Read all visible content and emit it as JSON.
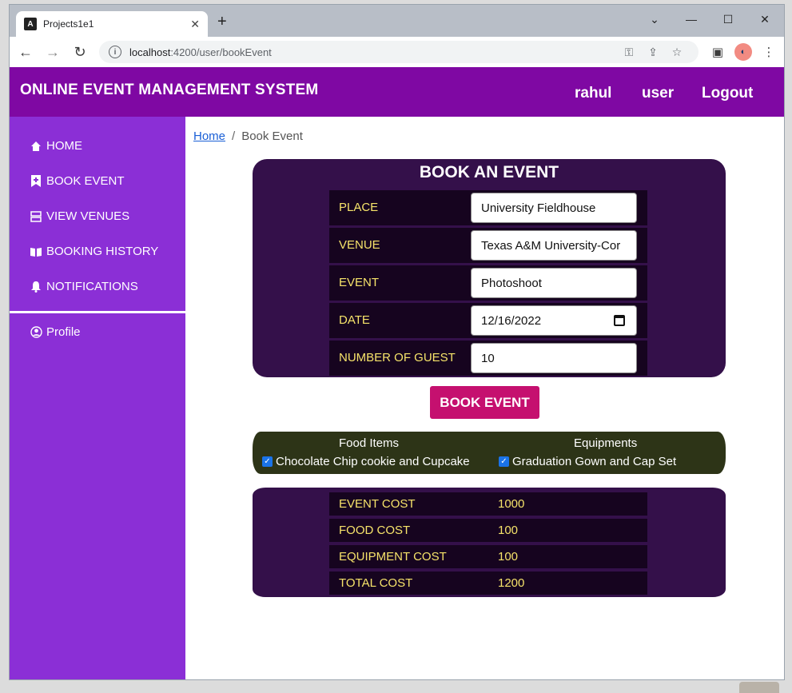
{
  "browser": {
    "tab_title": "Projects1e1",
    "new_tab": "+",
    "url_host": "localhost",
    "url_path": ":4200/user/bookEvent"
  },
  "header": {
    "app_title": "ONLINE EVENT MANAGEMENT SYSTEM",
    "user_name": "rahul",
    "role": "user",
    "logout": "Logout"
  },
  "sidebar": {
    "items": [
      {
        "label": "HOME",
        "icon": "home-icon"
      },
      {
        "label": "BOOK EVENT",
        "icon": "bookmark-plus-icon"
      },
      {
        "label": "VIEW VENUES",
        "icon": "stack-icon"
      },
      {
        "label": "BOOKING HISTORY",
        "icon": "book-open-icon"
      },
      {
        "label": "NOTIFICATIONS",
        "icon": "bell-icon"
      }
    ],
    "profile": "Profile"
  },
  "breadcrumb": {
    "home": "Home",
    "separator": "/",
    "current": "Book Event"
  },
  "booking": {
    "title": "BOOK AN EVENT",
    "fields": [
      {
        "label": "PLACE",
        "value": "University Fieldhouse"
      },
      {
        "label": "VENUE",
        "value": "Texas A&M University-Cor"
      },
      {
        "label": "EVENT",
        "value": "Photoshoot"
      },
      {
        "label": "DATE",
        "value": "12/16/2022"
      },
      {
        "label": "NUMBER OF GUEST",
        "value": "10"
      }
    ],
    "submit": "BOOK EVENT"
  },
  "extras": {
    "food_heading": "Food Items",
    "food_item": "Chocolate Chip cookie and Cupcake",
    "equip_heading": "Equipments",
    "equip_item": "Graduation Gown and Cap Set"
  },
  "costs": [
    {
      "label": "EVENT COST",
      "value": "1000"
    },
    {
      "label": "FOOD COST",
      "value": "100"
    },
    {
      "label": "EQUIPMENT COST",
      "value": "100"
    },
    {
      "label": "TOTAL COST",
      "value": "1200"
    }
  ],
  "colors": {
    "header": "#7f08a3",
    "sidebar": "#8b2fd6",
    "panel": "#34104a",
    "row": "#16041f",
    "label": "#f6e36a",
    "button": "#c5106f",
    "extras": "#2d3417"
  }
}
